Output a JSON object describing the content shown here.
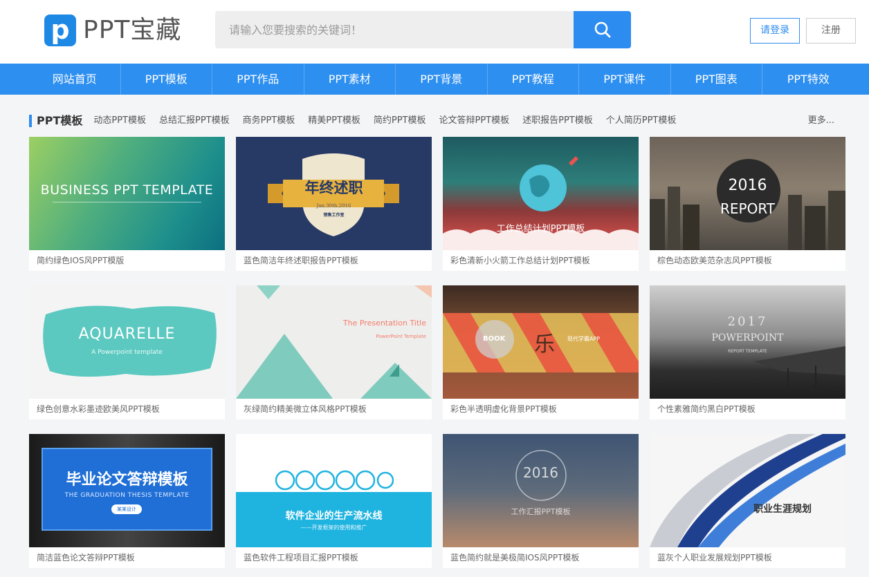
{
  "header": {
    "logo_letter": "p",
    "logo_text": "PPT宝藏",
    "search_placeholder": "请输入您要搜索的关键词！",
    "login_label": "请登录",
    "register_label": "注册"
  },
  "nav": [
    "网站首页",
    "PPT模板",
    "PPT作品",
    "PPT素材",
    "PPT背景",
    "PPT教程",
    "PPT课件",
    "PPT图表",
    "PPT特效"
  ],
  "category": {
    "title": "PPT模板",
    "links": [
      "动态PPT模板",
      "总结汇报PPT模板",
      "商务PPT模板",
      "精美PPT模板",
      "简约PPT模板",
      "论文答辩PPT模板",
      "述职报告PPT模板",
      "个人简历PPT模板"
    ],
    "more": "更多..."
  },
  "cards": [
    {
      "caption": "简约绿色IOS风PPT模版",
      "text1": "BUSINESS PPT TEMPLATE"
    },
    {
      "caption": "蓝色简洁年终述职报告PPT模板",
      "text1": "年终述职",
      "text2": "Jan.30th.2016",
      "text3": "销售工作室"
    },
    {
      "caption": "彩色清新小火箭工作总结计划PPT模板",
      "text1": "工作总结计划PPT模板"
    },
    {
      "caption": "棕色动态欧美范杂志风PPT模板",
      "text1": "2016",
      "text2": "REPORT"
    },
    {
      "caption": "绿色创意水彩墨迹欧美风PPT模板",
      "text1": "AQUARELLE",
      "text2": "A Powerpoint template"
    },
    {
      "caption": "灰绿简约精美微立体风格PPT模板",
      "text1": "The Presentation Title",
      "text2": "PowerPoint Template"
    },
    {
      "caption": "彩色半透明虚化背景PPT模板",
      "text1": "BOOK",
      "text2": "乐",
      "text3": "现代学霸APP"
    },
    {
      "caption": "个性素雅简约黑白PPT模板",
      "text1": "2017",
      "text2": "POWERPOINT",
      "text3": "REPORT TEMPLATE"
    },
    {
      "caption": "简洁蓝色论文答辩PPT模板",
      "text1": "毕业论文答辩模板",
      "text2": "THE GRADUATION THESIS TEMPLATE",
      "text3": "某某设计"
    },
    {
      "caption": "蓝色软件工程项目汇报PPT模板",
      "text1": "软件企业的生产流水线",
      "text2": "——开发框架的使用和推广"
    },
    {
      "caption": "蓝色简约就是美极简IOS风PPT模板",
      "text1": "2016",
      "text2": "工作汇报PPT模板"
    },
    {
      "caption": "蓝灰个人职业发展规划PPT模板",
      "text1": "职业生涯规划"
    }
  ]
}
